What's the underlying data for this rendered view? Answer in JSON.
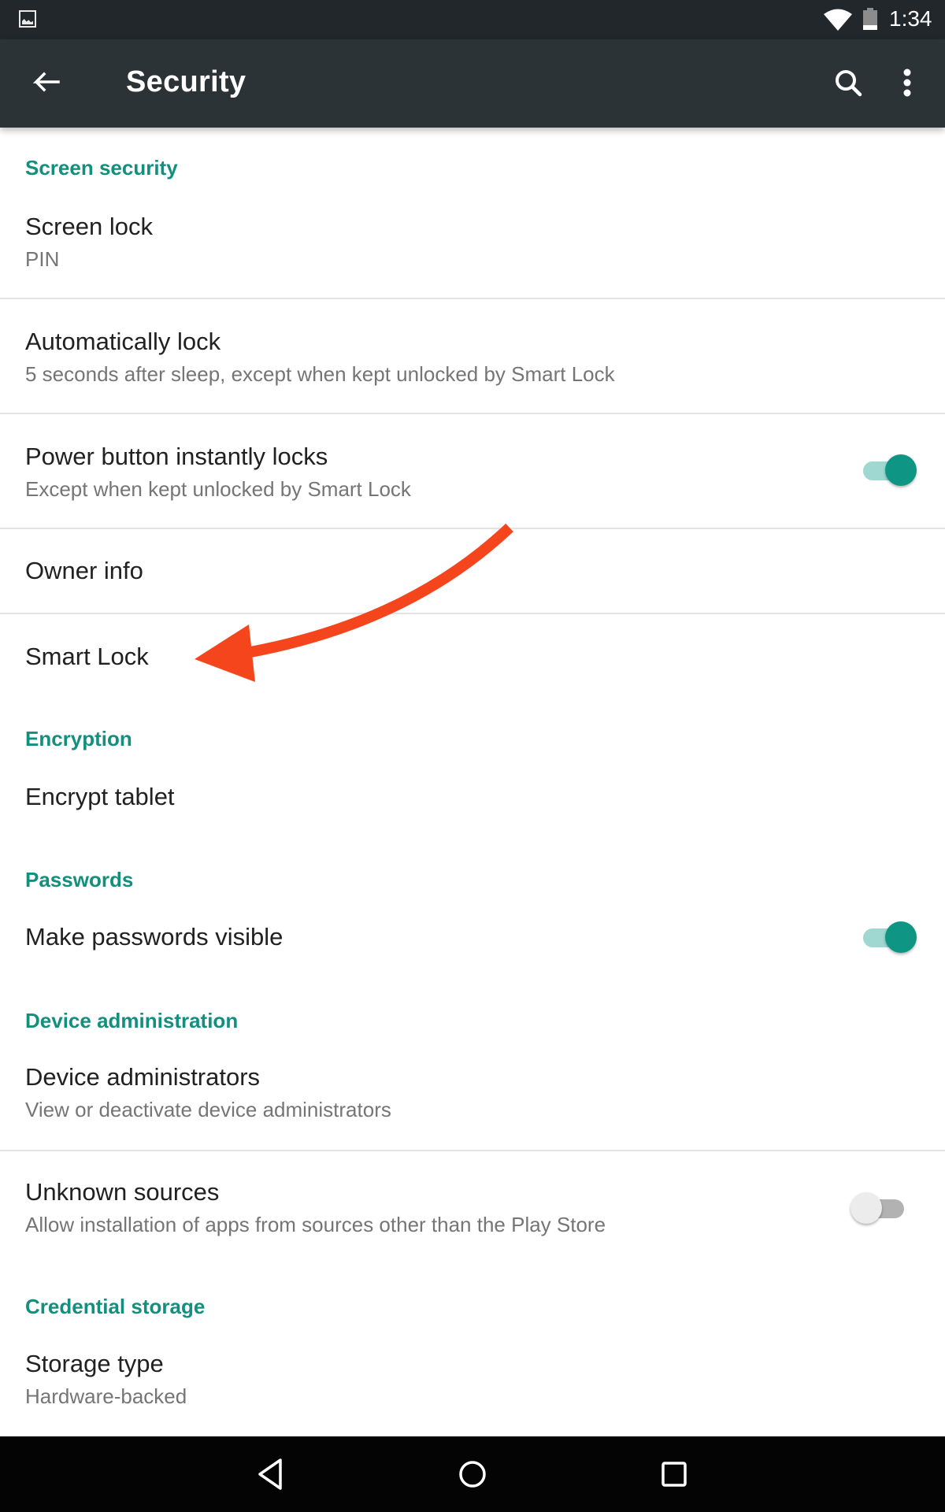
{
  "status_bar": {
    "time": "1:34",
    "icons": [
      "gallery-notification-icon",
      "wifi-icon",
      "battery-icon"
    ]
  },
  "toolbar": {
    "title": "Security",
    "back_icon": "arrow-back-icon",
    "search_icon": "search-icon",
    "more_icon": "more-vert-icon"
  },
  "sections": {
    "screen_security": {
      "header": "Screen security",
      "screen_lock": {
        "title": "Screen lock",
        "summary": "PIN"
      },
      "automatically_lock": {
        "title": "Automatically lock",
        "summary": "5 seconds after sleep, except when kept unlocked by Smart Lock"
      },
      "power_button": {
        "title": "Power button instantly locks",
        "summary": "Except when kept unlocked by Smart Lock",
        "checked": true
      },
      "owner_info": {
        "title": "Owner info"
      },
      "smart_lock": {
        "title": "Smart Lock"
      }
    },
    "encryption": {
      "header": "Encryption",
      "encrypt_tablet": {
        "title": "Encrypt tablet"
      }
    },
    "passwords": {
      "header": "Passwords",
      "make_visible": {
        "title": "Make passwords visible",
        "checked": true
      }
    },
    "device_admin": {
      "header": "Device administration",
      "administrators": {
        "title": "Device administrators",
        "summary": "View or deactivate device administrators"
      },
      "unknown_sources": {
        "title": "Unknown sources",
        "summary": "Allow installation of apps from sources other than the Play Store",
        "checked": false
      }
    },
    "credential_storage": {
      "header": "Credential storage",
      "storage_type": {
        "title": "Storage type",
        "summary": "Hardware-backed"
      }
    }
  },
  "annotation": {
    "type": "arrow",
    "points_to": "Smart Lock",
    "color": "#f4451d"
  },
  "nav_bar": {
    "back": "nav-back-icon",
    "home": "nav-home-icon",
    "recents": "nav-recents-icon"
  },
  "colors": {
    "accent": "#138f7e",
    "toolbar": "#2b3337",
    "statusbar": "#22272b",
    "toggle_on": "#0f9584"
  }
}
